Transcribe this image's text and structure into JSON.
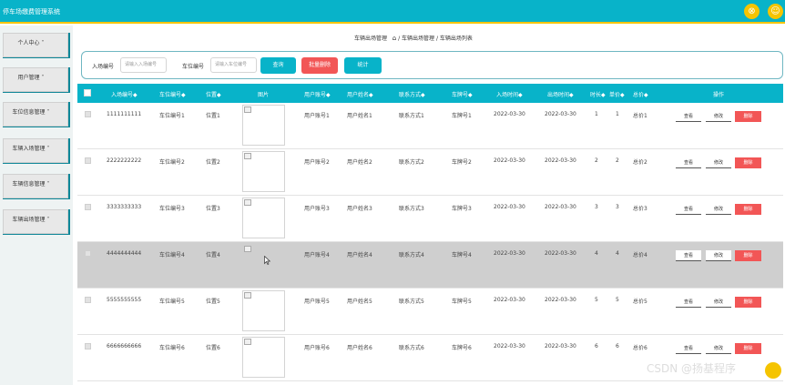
{
  "app": {
    "title": "停车场缴费管理系统",
    "close_icon": "⊗",
    "user_icon": "☺"
  },
  "sidebar": {
    "items": [
      {
        "label": "个人中心"
      },
      {
        "label": "用户管理"
      },
      {
        "label": "车位信息管理"
      },
      {
        "label": "车辆入场管理"
      },
      {
        "label": "车辆信息管理"
      },
      {
        "label": "车辆出场管理"
      }
    ],
    "dropdown_marker": "˅"
  },
  "breadcrumb": {
    "first": "车辆出场管理",
    "rest": "/ 车辆出场管理 / 车辆出场列表"
  },
  "search": {
    "entry_label": "入场编号",
    "entry_placeholder": "请输入入场编号",
    "spot_label": "车位编号",
    "spot_placeholder": "请输入车位编号",
    "query_btn": "查询",
    "batch_delete_btn": "批量删除",
    "stats_btn": "统计"
  },
  "table": {
    "headers": {
      "entry_no": "入场编号◆",
      "spot_no": "车位编号◆",
      "position": "位置◆",
      "image": "图片",
      "user_account": "用户账号◆",
      "user_name": "用户姓名◆",
      "contact": "联系方式◆",
      "plate": "车牌号◆",
      "in_time": "入场时间◆",
      "out_time": "出场时间◆",
      "duration": "时长◆",
      "unit_price": "单价◆",
      "total": "总价◆",
      "actions": "操作"
    },
    "view_label": "查看",
    "edit_label": "修改",
    "delete_label": "删除",
    "rows": [
      {
        "entry_no": "1111111111",
        "spot_no": "车位编号1",
        "position": "位置1",
        "user_account": "用户账号1",
        "user_name": "用户姓名1",
        "contact": "联系方式1",
        "plate": "车牌号1",
        "in_time": "2022-03-30",
        "out_time": "2022-03-30",
        "duration": "1",
        "unit_price": "1",
        "total": "总价1"
      },
      {
        "entry_no": "2222222222",
        "spot_no": "车位编号2",
        "position": "位置2",
        "user_account": "用户账号2",
        "user_name": "用户姓名2",
        "contact": "联系方式2",
        "plate": "车牌号2",
        "in_time": "2022-03-30",
        "out_time": "2022-03-30",
        "duration": "2",
        "unit_price": "2",
        "total": "总价2"
      },
      {
        "entry_no": "3333333333",
        "spot_no": "车位编号3",
        "position": "位置3",
        "user_account": "用户账号3",
        "user_name": "用户姓名3",
        "contact": "联系方式3",
        "plate": "车牌号3",
        "in_time": "2022-03-30",
        "out_time": "2022-03-30",
        "duration": "3",
        "unit_price": "3",
        "total": "总价3"
      },
      {
        "entry_no": "4444444444",
        "spot_no": "车位编号4",
        "position": "位置4",
        "user_account": "用户账号4",
        "user_name": "用户姓名4",
        "contact": "联系方式4",
        "plate": "车牌号4",
        "in_time": "2022-03-30",
        "out_time": "2022-03-30",
        "duration": "4",
        "unit_price": "4",
        "total": "总价4"
      },
      {
        "entry_no": "5555555555",
        "spot_no": "车位编号5",
        "position": "位置5",
        "user_account": "用户账号5",
        "user_name": "用户姓名5",
        "contact": "联系方式5",
        "plate": "车牌号5",
        "in_time": "2022-03-30",
        "out_time": "2022-03-30",
        "duration": "5",
        "unit_price": "5",
        "total": "总价5"
      },
      {
        "entry_no": "6666666666",
        "spot_no": "车位编号6",
        "position": "位置6",
        "user_account": "用户账号6",
        "user_name": "用户姓名6",
        "contact": "联系方式6",
        "plate": "车牌号6",
        "in_time": "2022-03-30",
        "out_time": "2022-03-30",
        "duration": "6",
        "unit_price": "6",
        "total": "总价6"
      }
    ]
  },
  "watermark": "CSDN @扬基程序",
  "colors": {
    "primary": "#08b3c9",
    "accent": "#f5c400",
    "danger": "#f25656",
    "sidebar_edge": "#0e8798"
  }
}
